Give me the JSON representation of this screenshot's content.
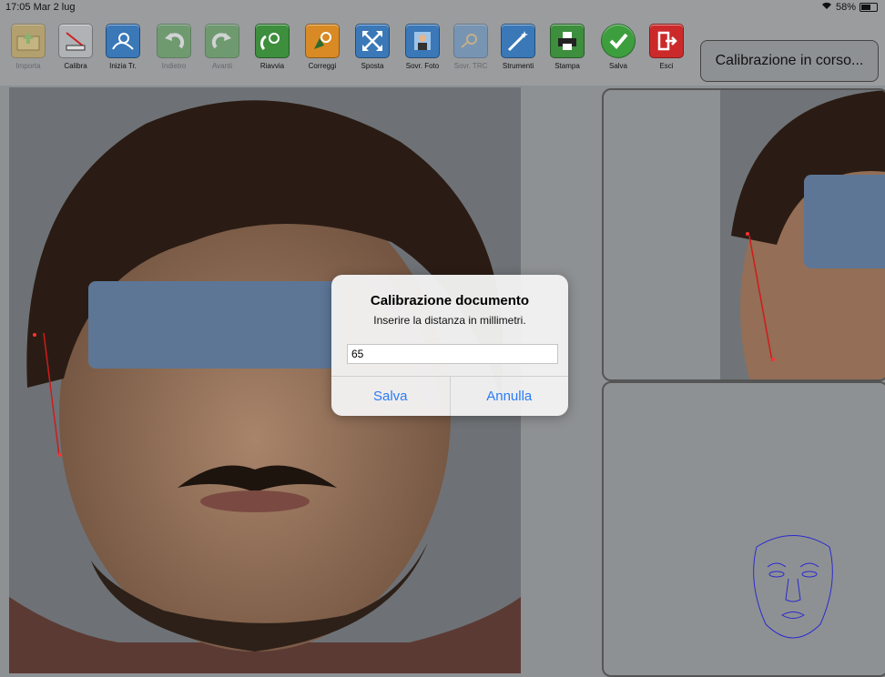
{
  "status": {
    "time": "17:05  Mar 2 lug",
    "battery": "58%"
  },
  "toolbar": {
    "items": [
      {
        "label": "Importa",
        "color": "#c9a44a",
        "enabled": false
      },
      {
        "label": "Calibra",
        "color": "#b0b3b6",
        "enabled": true
      },
      {
        "label": "Inizia Tr.",
        "color": "#3a78b8",
        "enabled": true
      },
      {
        "label": "Indietro",
        "color": "#4c9a4c",
        "enabled": false
      },
      {
        "label": "Avanti",
        "color": "#4c9a4c",
        "enabled": false
      },
      {
        "label": "Riavvia",
        "color": "#3d8e3d",
        "enabled": true
      },
      {
        "label": "Correggi",
        "color": "#d98a24",
        "enabled": true
      },
      {
        "label": "Sposta",
        "color": "#3a78b8",
        "enabled": true
      },
      {
        "label": "Sovr. Foto",
        "color": "#3a78b8",
        "enabled": true
      },
      {
        "label": "Sovr. TRC",
        "color": "#5c8fc5",
        "enabled": false
      },
      {
        "label": "Strumenti",
        "color": "#3a78b8",
        "enabled": true
      },
      {
        "label": "Stampa",
        "color": "#3d8e3d",
        "enabled": true
      },
      {
        "label": "Salva",
        "color": "#3d9e3d",
        "enabled": true
      },
      {
        "label": "Esci",
        "color": "#cc2a2a",
        "enabled": true
      }
    ],
    "status_text": "Calibrazione in corso..."
  },
  "dialog": {
    "title": "Calibrazione documento",
    "message": "Inserire la distanza in millimetri.",
    "value": "65",
    "save_label": "Salva",
    "cancel_label": "Annulla"
  }
}
